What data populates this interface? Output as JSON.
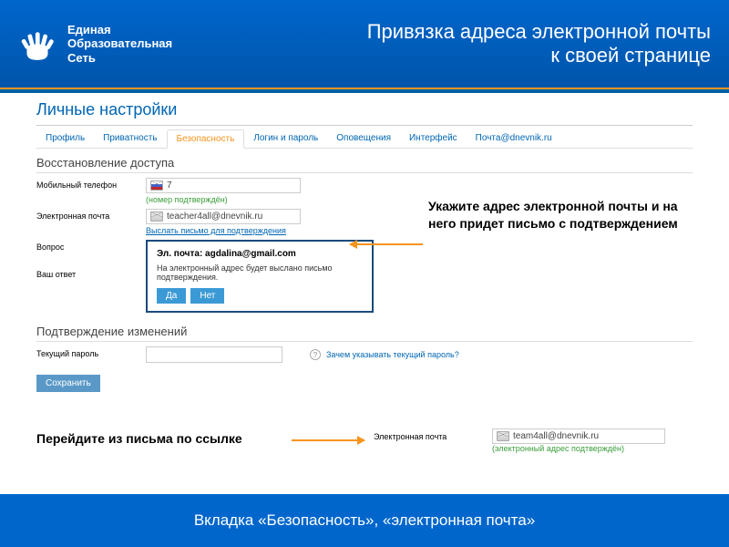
{
  "brand": {
    "line1": "Единая",
    "line2": "Образовательная",
    "line3": "Сеть"
  },
  "header_title_l1": "Привязка адреса электронной почты",
  "header_title_l2": "к своей странице",
  "page_title": "Личные настройки",
  "tabs": {
    "profile": "Профиль",
    "privacy": "Приватность",
    "security": "Безопасность",
    "login": "Логин и пароль",
    "notif": "Оповещения",
    "iface": "Интерфейс",
    "mail": "Почта@dnevnik.ru"
  },
  "sections": {
    "recovery": "Восстановление доступа",
    "confirm": "Подтверждение изменений"
  },
  "fields": {
    "phone_label": "Мобильный телефон",
    "phone_value": "7",
    "phone_hint": "(номер подтверждён)",
    "email_label": "Электронная почта",
    "email_value": "teacher4all@dnevnik.ru",
    "email_link": "Выслать письмо для подтверждения",
    "question_label": "Вопрос",
    "answer_label": "Ваш ответ",
    "password_label": "Текущий пароль"
  },
  "popup": {
    "title": "Эл. почта: agdalina@gmail.com",
    "text": "На электронный адрес будет выслано письмо подтверждения.",
    "yes": "Да",
    "no": "Нет"
  },
  "save_btn": "Сохранить",
  "help_link": "Зачем указывать текущий пароль?",
  "callout1": "Укажите адрес электронной почты и на него придет письмо с подтверждением",
  "callout2": "Перейдите из письма по ссылке",
  "confirmed_email": {
    "label": "Электронная почта",
    "value": "team4all@dnevnik.ru",
    "hint": "(электронный адрес подтверждён)"
  },
  "footer": "Вкладка «Безопасность», «электронная почта»"
}
